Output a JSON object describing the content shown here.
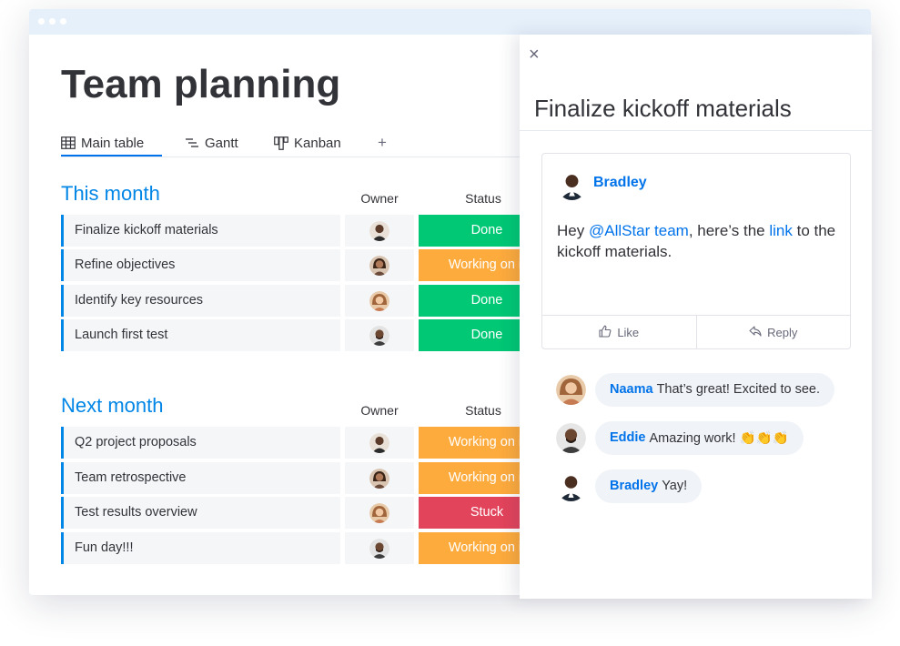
{
  "board": {
    "title": "Team planning",
    "tabs": [
      {
        "label": "Main table",
        "icon": "table-icon",
        "active": true
      },
      {
        "label": "Gantt",
        "icon": "gantt-icon",
        "active": false
      },
      {
        "label": "Kanban",
        "icon": "kanban-icon",
        "active": false
      }
    ],
    "add_tab": "+",
    "columns": {
      "owner": "Owner",
      "status": "Status"
    },
    "groups": [
      {
        "title": "This month",
        "color": "#0086e6",
        "rows": [
          {
            "name": "Finalize kickoff materials",
            "status": "Done",
            "status_color": "#00c875"
          },
          {
            "name": "Refine objectives",
            "status": "Working on it",
            "status_color": "#fdab3d"
          },
          {
            "name": "Identify key resources",
            "status": "Done",
            "status_color": "#00c875"
          },
          {
            "name": "Launch first test",
            "status": "Done",
            "status_color": "#00c875"
          }
        ]
      },
      {
        "title": "Next month",
        "color": "#0086e6",
        "rows": [
          {
            "name": "Q2 project proposals",
            "status": "Working on it",
            "status_color": "#fdab3d"
          },
          {
            "name": "Team retrospective",
            "status": "Working on it",
            "status_color": "#fdab3d"
          },
          {
            "name": "Test results overview",
            "status": "Stuck",
            "status_color": "#e2445c"
          },
          {
            "name": "Fun day!!!",
            "status": "Working on it",
            "status_color": "#fdab3d"
          }
        ]
      }
    ]
  },
  "panel": {
    "close": "×",
    "title": "Finalize kickoff materials",
    "update": {
      "author": "Bradley",
      "text_before": "Hey ",
      "mention": "@AllStar team",
      "text_middle": ", here’s the ",
      "link": "link",
      "text_after": " to the kickoff materials.",
      "like_label": "Like",
      "reply_label": "Reply"
    },
    "replies": [
      {
        "author": "Naama",
        "text": "That’s great! Excited to see."
      },
      {
        "author": "Eddie",
        "text": "Amazing work! 👏👏👏"
      },
      {
        "author": "Bradley",
        "text": "Yay!"
      }
    ]
  },
  "colors": {
    "accent": "#0073ea",
    "group_blue": "#0086e6",
    "done": "#00c875",
    "working": "#fdab3d",
    "stuck": "#e2445c"
  }
}
